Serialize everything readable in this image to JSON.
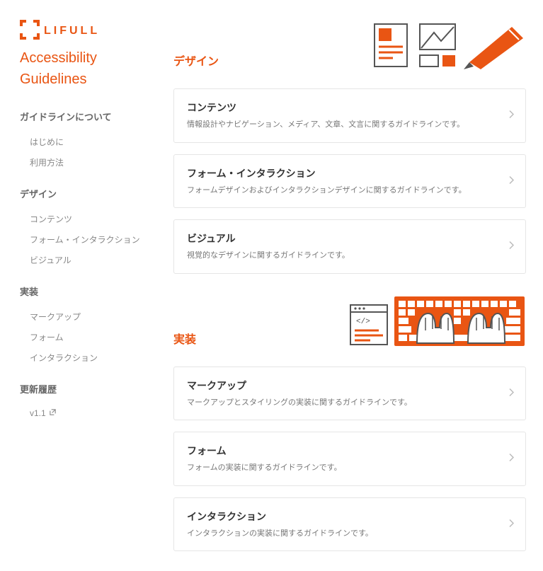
{
  "brand": {
    "name": "LIFULL",
    "title_line1": "Accessibility",
    "title_line2": "Guidelines",
    "accent": "#e95513"
  },
  "sidebar": {
    "sections": [
      {
        "heading": "ガイドラインについて",
        "items": [
          {
            "label": "はじめに"
          },
          {
            "label": "利用方法"
          }
        ]
      },
      {
        "heading": "デザイン",
        "items": [
          {
            "label": "コンテンツ"
          },
          {
            "label": "フォーム・インタラクション"
          },
          {
            "label": "ビジュアル"
          }
        ]
      },
      {
        "heading": "実装",
        "items": [
          {
            "label": "マークアップ"
          },
          {
            "label": "フォーム"
          },
          {
            "label": "インタラクション"
          }
        ]
      },
      {
        "heading": "更新履歴",
        "items": [
          {
            "label": "v1.1",
            "external": true
          }
        ]
      }
    ]
  },
  "sections": [
    {
      "title": "デザイン",
      "illus": "design",
      "cards": [
        {
          "title": "コンテンツ",
          "desc": "情報設計やナビゲーション、メディア、文章、文言に関するガイドラインです。"
        },
        {
          "title": "フォーム・インタラクション",
          "desc": "フォームデザインおよびインタラクションデザインに関するガイドラインです。"
        },
        {
          "title": "ビジュアル",
          "desc": "視覚的なデザインに関するガイドラインです。"
        }
      ]
    },
    {
      "title": "実装",
      "illus": "implementation",
      "cards": [
        {
          "title": "マークアップ",
          "desc": "マークアップとスタイリングの実装に関するガイドラインです。"
        },
        {
          "title": "フォーム",
          "desc": "フォームの実装に関するガイドラインです。"
        },
        {
          "title": "インタラクション",
          "desc": "インタラクションの実装に関するガイドラインです。"
        }
      ]
    }
  ]
}
